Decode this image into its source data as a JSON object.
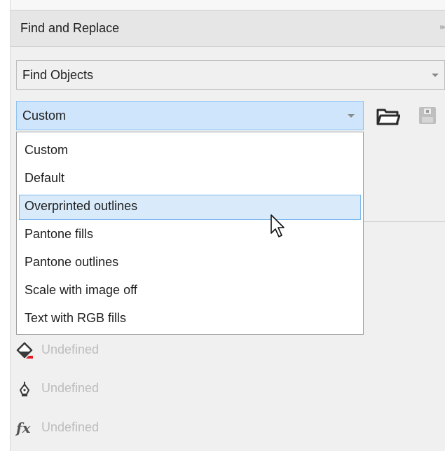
{
  "panel": {
    "title": "Find and Replace",
    "expand_glyph": "▸▸"
  },
  "find_mode": {
    "selected": "Find Objects"
  },
  "preset": {
    "selected": "Custom"
  },
  "preset_options": [
    "Custom",
    "Default",
    "Overprinted outlines",
    "Pantone fills",
    "Pantone outlines",
    "Scale with image off",
    "Text with RGB fills"
  ],
  "highlighted_option": "Overprinted outlines",
  "properties": [
    {
      "icon": "fill-bucket-icon",
      "label": "Undefined"
    },
    {
      "icon": "pen-nib-icon",
      "label": "Undefined"
    },
    {
      "icon": "fx-icon",
      "label": "Undefined"
    }
  ],
  "icons": {
    "open_preset": "folder-icon",
    "save_preset": "save-icon"
  },
  "colors": {
    "accent": "#cfe5fb",
    "highlight": "#d9ebfb",
    "disabled_text": "#bdbdbd"
  }
}
